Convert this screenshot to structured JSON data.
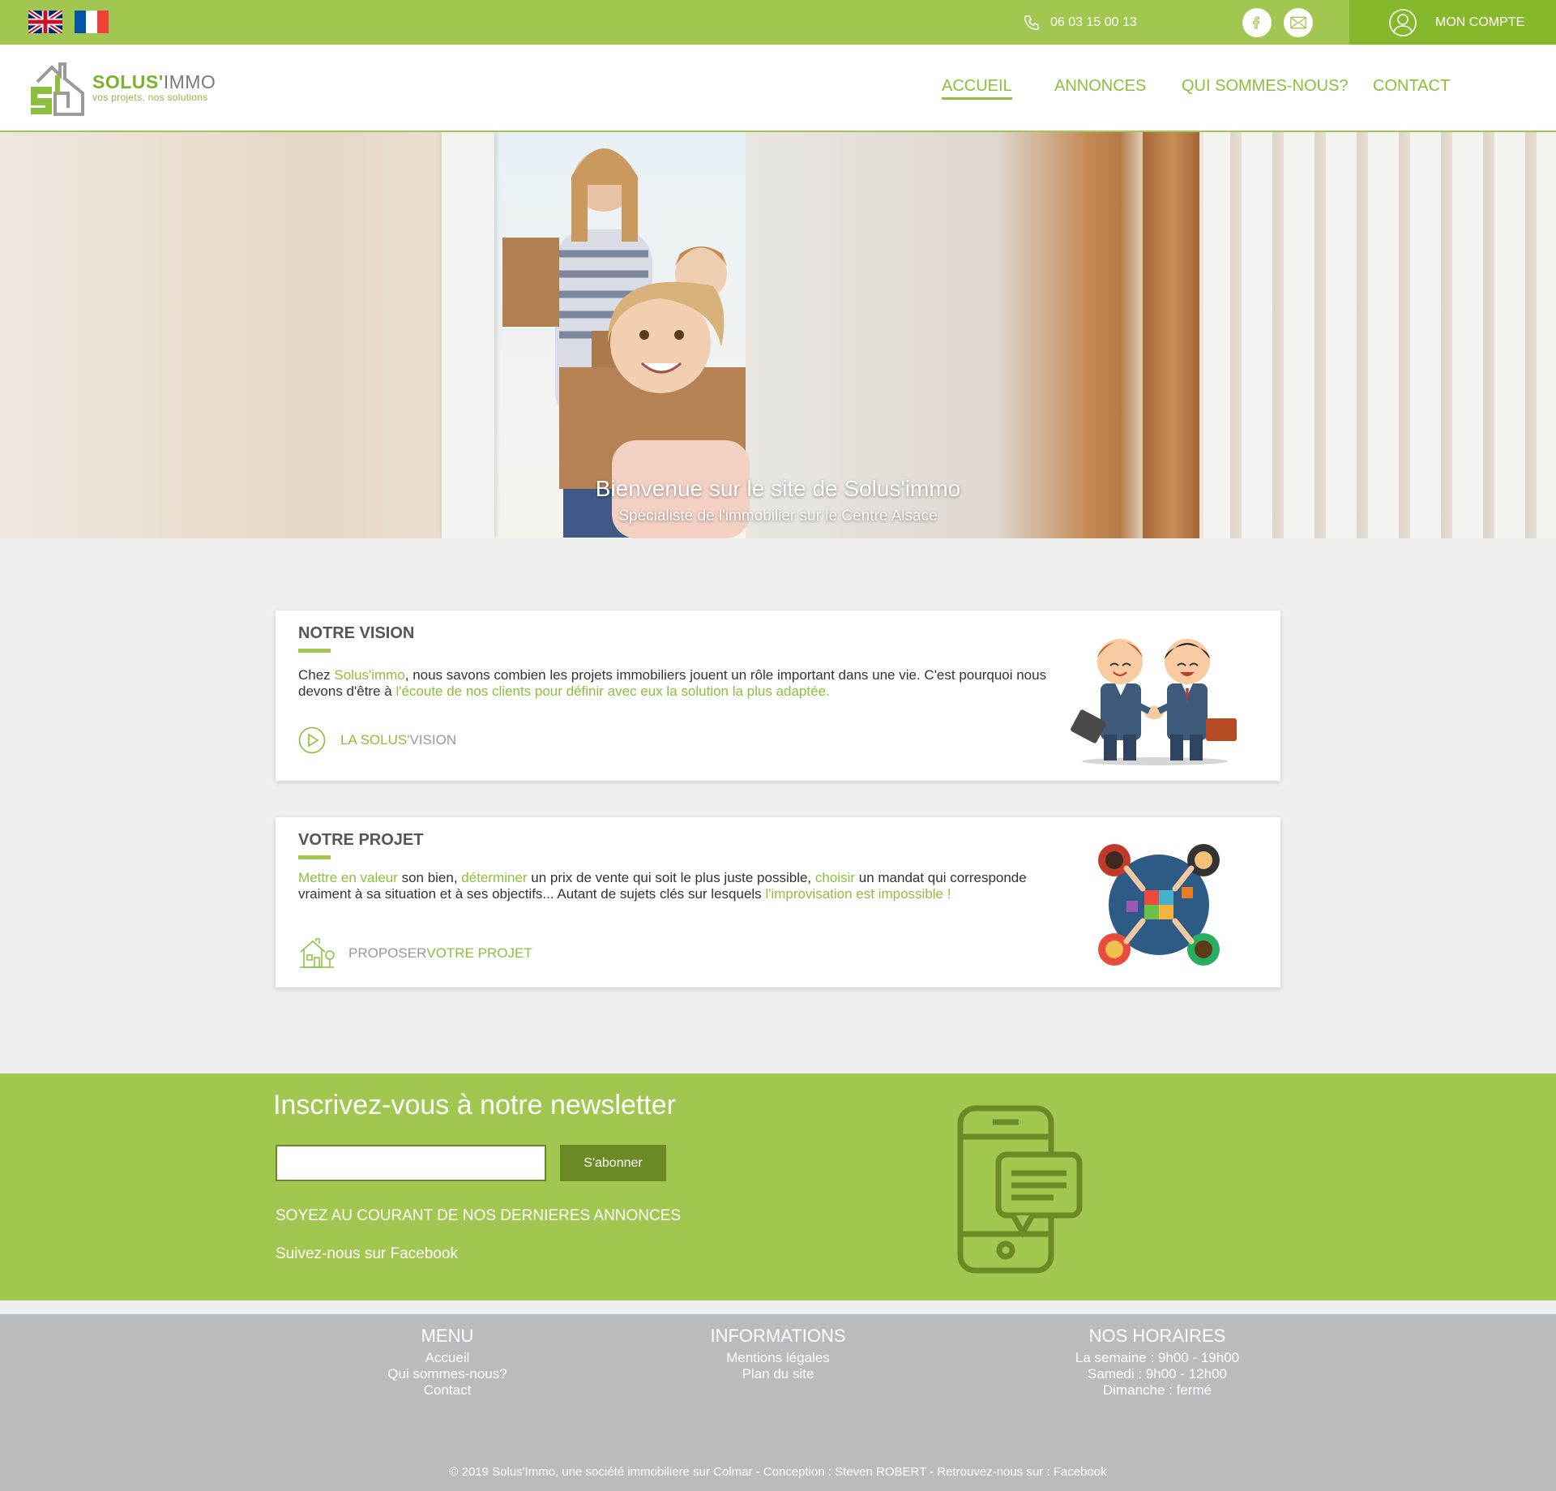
{
  "colors": {
    "brand_green": "#a2c751",
    "account_green": "#85b82a",
    "dark_green": "#6b8a26",
    "footer_gray": "#b8bcbe"
  },
  "topbar": {
    "flags": [
      "uk-flag",
      "fr-flag"
    ],
    "phone": "06 03 15 00 13",
    "social": [
      "facebook-icon",
      "mail-icon"
    ],
    "account_label": "MON COMPTE"
  },
  "header": {
    "logo": {
      "name_bold": "SOLUS'",
      "name_light": "IMMO",
      "tagline": "vos projets, nos solutions"
    },
    "nav": [
      {
        "label": "ACCUEIL",
        "active": true
      },
      {
        "label": "ANNONCES"
      },
      {
        "label": "QUI SOMMES-NOUS?"
      },
      {
        "label": "CONTACT"
      }
    ]
  },
  "hero": {
    "title": "Bienvenue sur le site de Solus'immo",
    "subtitle": "Spécialiste de l'immobilier sur le Centre Alsace"
  },
  "vision": {
    "title": "NOTRE VISION",
    "text_1": "Chez ",
    "text_2": "Solus'immo",
    "text_3": ", nous savons combien les projets immobiliers jouent un rôle important dans une vie. C'est pourquoi nous devons d'être à ",
    "text_4": "l'écoute de nos clients pour définir avec eux la solution la plus adaptée.",
    "link_green": "LA SOLUS'",
    "link_gray": "VISION"
  },
  "projet": {
    "title": "VOTRE PROJET",
    "t1": "Mettre en valeur",
    "t2": " son bien, ",
    "t3": "déterminer",
    "t4": " un prix de vente qui soit le plus juste possible, ",
    "t5": "choisir",
    "t6": " un mandat qui corresponde vraiment à sa situation et à ses objectifs... Autant de sujets clés sur lesquels ",
    "t7": "l'improvisation est impossible !",
    "link_gray": "PROPOSER ",
    "link_green": "VOTRE PROJET"
  },
  "newsletter": {
    "title": "Inscrivez-vous à notre newsletter",
    "input_value": "",
    "button": "S'abonner",
    "info": "SOYEZ AU COURANT DE NOS DERNIERES ANNONCES",
    "facebook": "Suivez-nous sur Facebook"
  },
  "footer": {
    "menu": {
      "title": "MENU",
      "items": [
        "Accueil",
        "Qui sommes-nous?",
        "Contact"
      ]
    },
    "info": {
      "title": "INFORMATIONS",
      "items": [
        "Mentions légales",
        "Plan du site"
      ]
    },
    "hours": {
      "title": "NOS HORAIRES",
      "items": [
        "La semaine : 9h00 - 19h00",
        "Samedi : 9h00 - 12h00",
        "Dimanche : fermé"
      ]
    },
    "copyright": "© 2019 Solus'Immo, une société immobiliere sur Colmar - Conception : Steven ROBERT - Retrouvez-nous sur : Facebook"
  }
}
